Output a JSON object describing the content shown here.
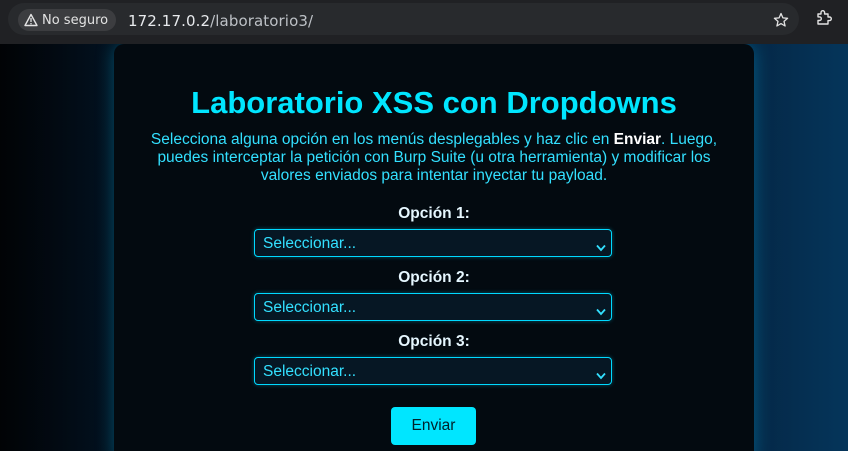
{
  "browser": {
    "security_label": "No seguro",
    "url_host": "172.17.0.2",
    "url_path": "/laboratorio3/"
  },
  "page": {
    "title": "Laboratorio XSS con Dropdowns",
    "intro_before": "Selecciona alguna opción en los menús desplegables y haz clic en ",
    "intro_bold": "Enviar",
    "intro_after": ". Luego, puedes interceptar la petición con Burp Suite (u otra herramienta) y modificar los valores enviados para intentar inyectar tu payload.",
    "fields": [
      {
        "label": "Opción 1:",
        "selected": "Seleccionar..."
      },
      {
        "label": "Opción 2:",
        "selected": "Seleccionar..."
      },
      {
        "label": "Opción 3:",
        "selected": "Seleccionar..."
      }
    ],
    "submit_label": "Enviar"
  },
  "colors": {
    "accent": "#00e6ff",
    "card_bg": "#030a10",
    "select_border": "#00d9ff"
  },
  "icons": {
    "security": "warning-triangle-icon",
    "bookmark": "star-icon",
    "extensions": "extension-icon",
    "select_arrow": "chevron-down-icon"
  }
}
